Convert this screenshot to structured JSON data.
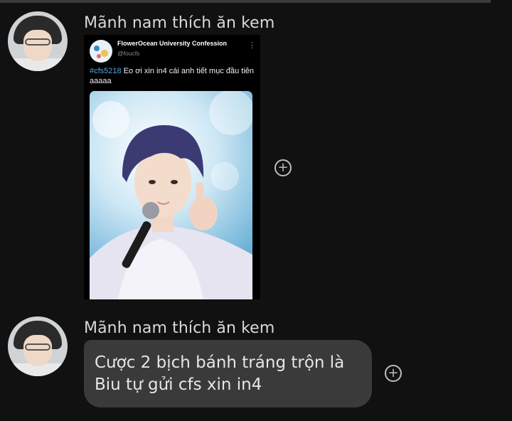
{
  "messages": [
    {
      "sender": "Mãnh nam thích ăn kem",
      "shared_post": {
        "page_name": "FlowerOcean University Confession",
        "handle": "@foucfs",
        "hashtag": "#cfs5218",
        "text": " Eo ơi xin in4 cái anh tiết mục đầu tiên aaaaa",
        "menu_icon": "more-vertical-icon"
      }
    },
    {
      "sender": "Mãnh nam thích ăn kem",
      "lines": [
        "Cược 2 bịch bánh tráng trộn là",
        "Biu tự gửi cfs xin in4"
      ]
    }
  ],
  "reaction_icon": "plus-circle-icon",
  "reaction_symbol": "+"
}
